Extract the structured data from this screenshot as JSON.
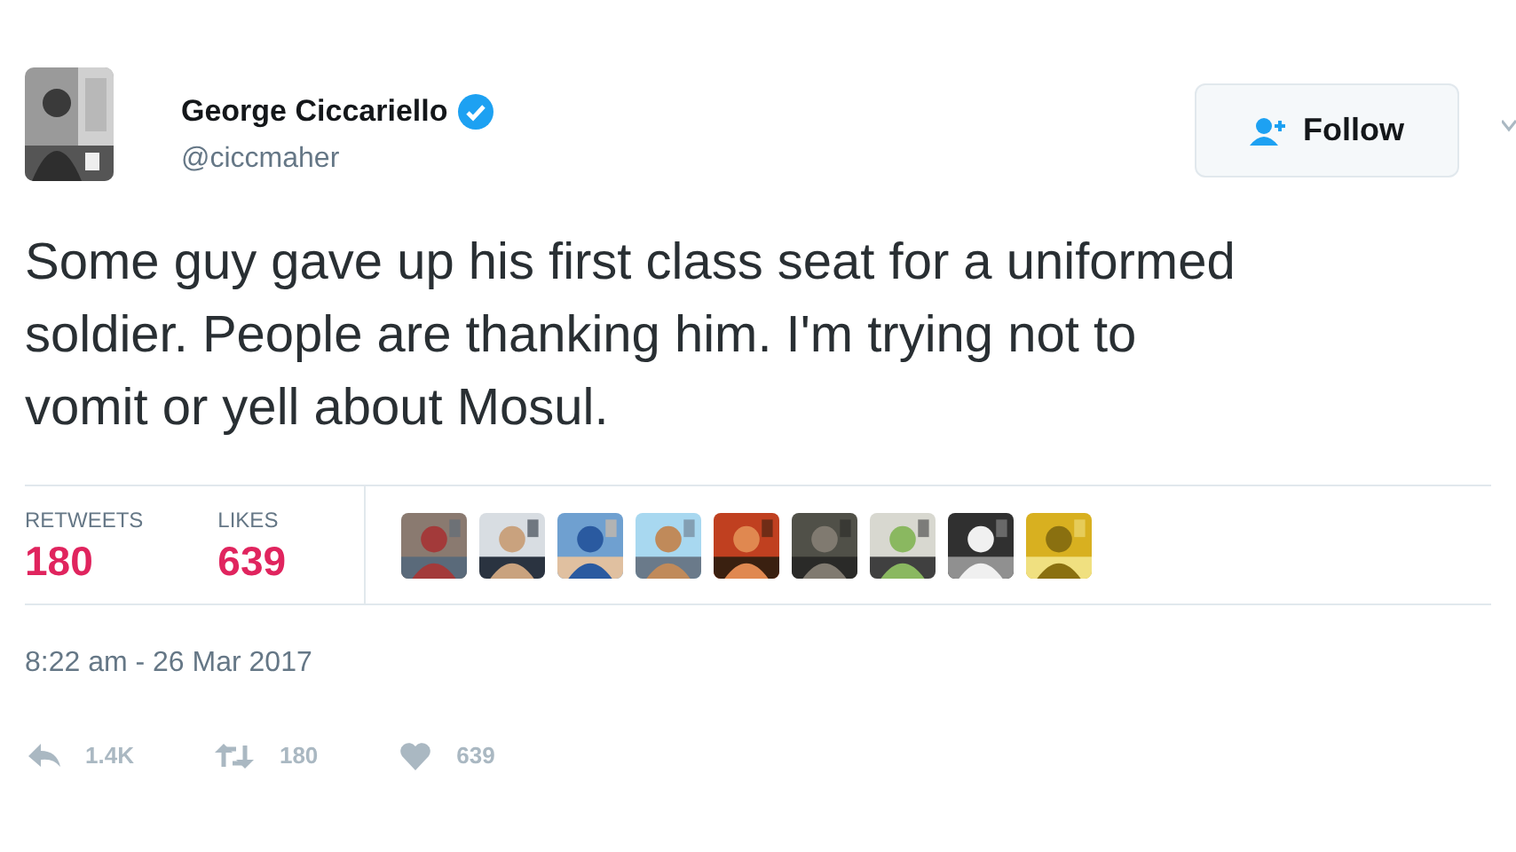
{
  "author": {
    "name": "George Ciccariello",
    "verified": true,
    "handle": "@ciccmaher"
  },
  "follow_button": {
    "label": "Follow"
  },
  "tweet_text": "Some guy gave up his first class seat for a uniformed soldier. People are thanking him. I'm trying not to vomit or yell about Mosul.",
  "stats": [
    {
      "label": "RETWEETS",
      "value": "180"
    },
    {
      "label": "LIKES",
      "value": "639"
    }
  ],
  "timestamp": "8:22 am - 26 Mar 2017",
  "actions": [
    {
      "kind": "reply",
      "count": "1.4K"
    },
    {
      "kind": "retweet",
      "count": "180"
    },
    {
      "kind": "like",
      "count": "639"
    }
  ]
}
